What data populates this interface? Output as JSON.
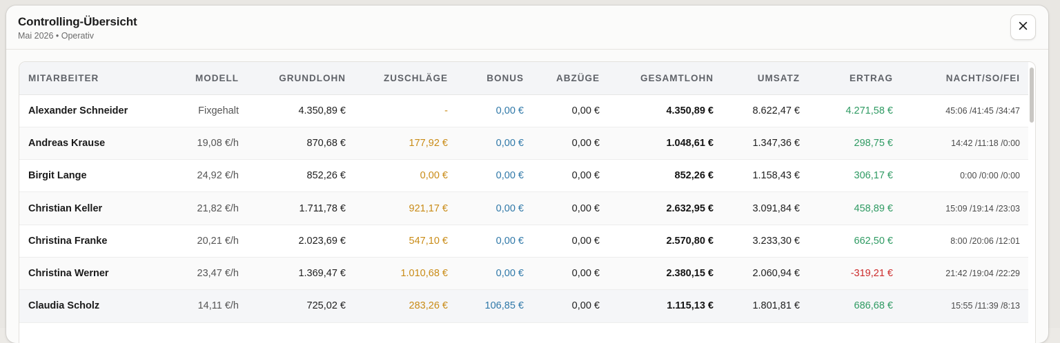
{
  "modal": {
    "title": "Controlling-Übersicht",
    "subtitle": "Mai 2026 • Operativ",
    "close_icon": "close-icon"
  },
  "colors": {
    "zuschlag": "#c98b16",
    "bonus": "#2f78a8",
    "ertrag_positive": "#2e9a62",
    "ertrag_negative": "#cc2b2b"
  },
  "table": {
    "headers": [
      "MITARBEITER",
      "MODELL",
      "GRUNDLOHN",
      "ZUSCHLÄGE",
      "BONUS",
      "ABZÜGE",
      "GESAMTLOHN",
      "UMSATZ",
      "ERTRAG",
      "NACHT/SO/FEI"
    ],
    "rows": [
      [
        "Alexander Schneider",
        "Fixgehalt",
        "4.350,89 €",
        "-",
        "0,00 €",
        "0,00 €",
        "4.350,89 €",
        "8.622,47 €",
        "4.271,58 €",
        "45:06 /41:45 /34:47"
      ],
      [
        "Andreas Krause",
        "19,08 €/h",
        "870,68 €",
        "177,92 €",
        "0,00 €",
        "0,00 €",
        "1.048,61 €",
        "1.347,36 €",
        "298,75 €",
        "14:42 /11:18 /0:00"
      ],
      [
        "Birgit Lange",
        "24,92 €/h",
        "852,26 €",
        "0,00 €",
        "0,00 €",
        "0,00 €",
        "852,26 €",
        "1.158,43 €",
        "306,17 €",
        "0:00 /0:00 /0:00"
      ],
      [
        "Christian Keller",
        "21,82 €/h",
        "1.711,78 €",
        "921,17 €",
        "0,00 €",
        "0,00 €",
        "2.632,95 €",
        "3.091,84 €",
        "458,89 €",
        "15:09 /19:14 /23:03"
      ],
      [
        "Christina Franke",
        "20,21 €/h",
        "2.023,69 €",
        "547,10 €",
        "0,00 €",
        "0,00 €",
        "2.570,80 €",
        "3.233,30 €",
        "662,50 €",
        "8:00 /20:06 /12:01"
      ],
      [
        "Christina Werner",
        "23,47 €/h",
        "1.369,47 €",
        "1.010,68 €",
        "0,00 €",
        "0,00 €",
        "2.380,15 €",
        "2.060,94 €",
        "-319,21 €",
        "21:42 /19:04 /22:29"
      ],
      [
        "Claudia Scholz",
        "14,11 €/h",
        "725,02 €",
        "283,26 €",
        "106,85 €",
        "0,00 €",
        "1.115,13 €",
        "1.801,81 €",
        "686,68 €",
        "15:55 /11:39 /8:13"
      ]
    ]
  }
}
